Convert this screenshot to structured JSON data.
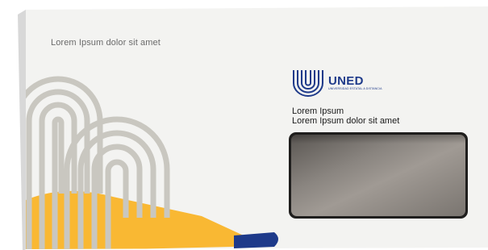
{
  "sender_line": "Lorem Ipsum dolor sit amet",
  "logo": {
    "name": "UNED",
    "tagline": "UNIVERSIDAD ESTATAL A DISTANCIA",
    "icon": "uned-concentric-u-icon"
  },
  "address": {
    "line1": "Lorem Ipsum",
    "line2": "Lorem Ipsum dolor sit amet"
  },
  "colors": {
    "brand_blue": "#1e3a8a",
    "accent_yellow": "#f9b833",
    "pattern_gray": "#c9c7c0",
    "paper": "#f3f3f1"
  }
}
